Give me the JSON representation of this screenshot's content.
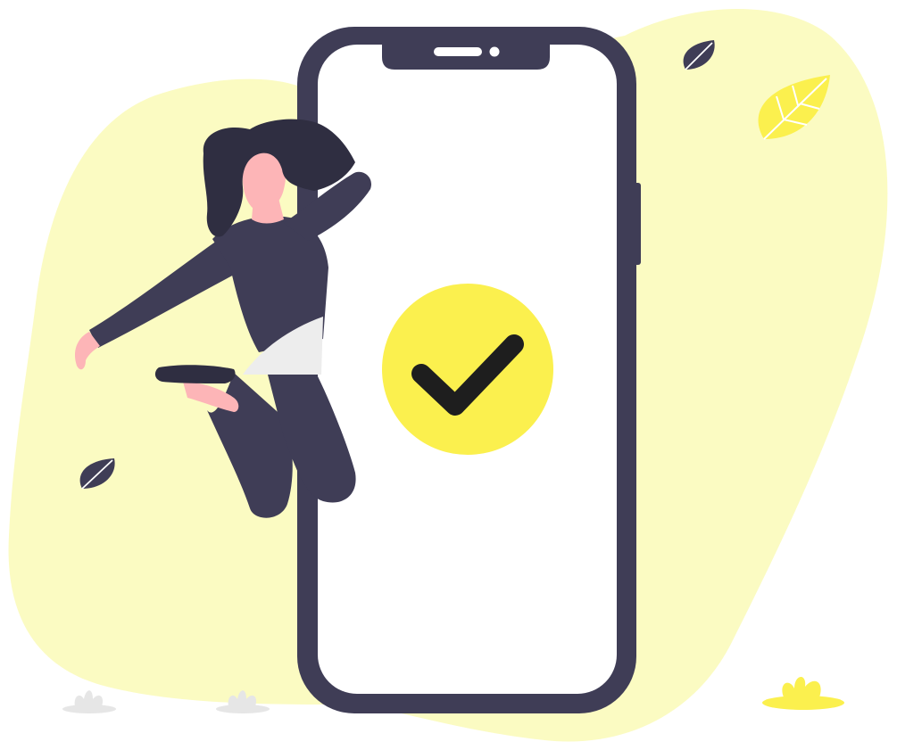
{
  "illustration": {
    "colors": {
      "blob": "#FBFBC2",
      "accent": "#FBF04E",
      "dark": "#3F3D56",
      "hair": "#2F2E41",
      "skin": "#FDB5B7",
      "shirt_hem": "#EDEDED",
      "screen": "#FFFFFF",
      "check": "#1E1E1E",
      "grass_grey": "#E6E6E6"
    },
    "icons": {
      "status": "check-circle-icon",
      "decor_leaf": "leaf-icon"
    }
  }
}
